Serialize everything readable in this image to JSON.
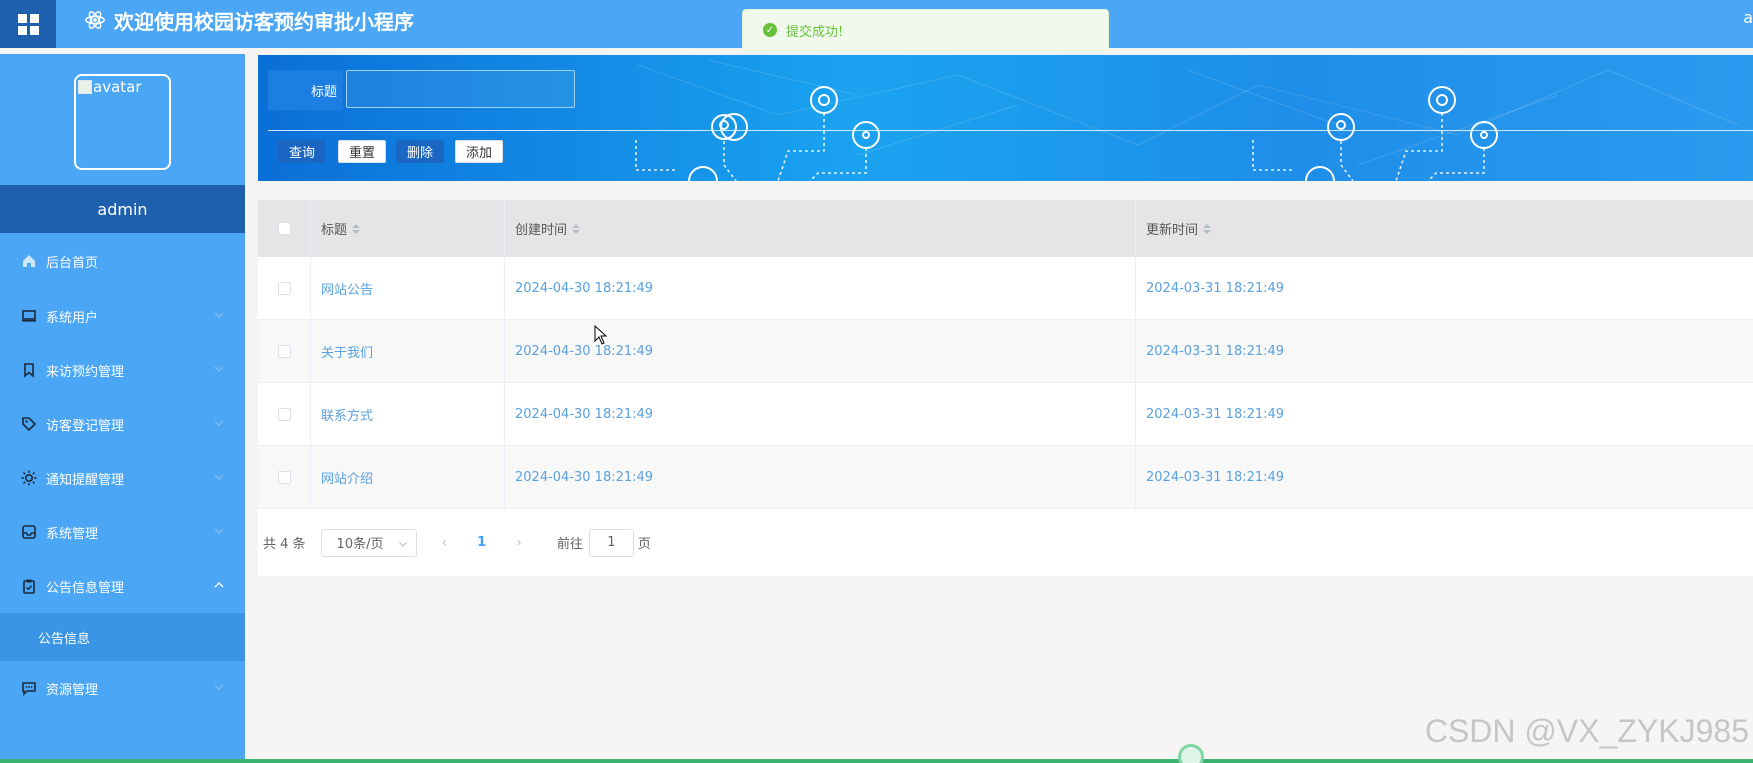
{
  "header": {
    "title": "欢迎使用校园访客预约审批小程序",
    "right_text": "a"
  },
  "toast": {
    "message": "提交成功!"
  },
  "sidebar": {
    "avatar_alt": "avatar",
    "username": "admin",
    "items": [
      {
        "label": "后台首页",
        "icon": "home-icon"
      },
      {
        "label": "系统用户",
        "icon": "monitor-icon"
      },
      {
        "label": "来访预约管理",
        "icon": "bookmark-icon"
      },
      {
        "label": "访客登记管理",
        "icon": "tag-icon"
      },
      {
        "label": "通知提醒管理",
        "icon": "sun-icon"
      },
      {
        "label": "系统管理",
        "icon": "inbox-icon"
      },
      {
        "label": "公告信息管理",
        "icon": "clipboard-icon"
      },
      {
        "label": "资源管理",
        "icon": "message-icon"
      }
    ],
    "sub_items": [
      {
        "label": "公告信息"
      }
    ]
  },
  "search": {
    "label": "标题",
    "value": "",
    "buttons": {
      "query": "查询",
      "reset": "重置",
      "delete": "删除",
      "add": "添加"
    }
  },
  "table": {
    "columns": [
      "标题",
      "创建时间",
      "更新时间"
    ],
    "rows": [
      {
        "title": "网站公告",
        "created": "2024-04-30 18:21:49",
        "updated": "2024-03-31 18:21:49"
      },
      {
        "title": "关于我们",
        "created": "2024-04-30 18:21:49",
        "updated": "2024-03-31 18:21:49"
      },
      {
        "title": "联系方式",
        "created": "2024-04-30 18:21:49",
        "updated": "2024-03-31 18:21:49"
      },
      {
        "title": "网站介绍",
        "created": "2024-04-30 18:21:49",
        "updated": "2024-03-31 18:21:49"
      }
    ]
  },
  "pagination": {
    "total": "共 4 条",
    "page_size": "10条/页",
    "current_page": "1",
    "goto_label": "前往",
    "goto_value": "1",
    "page_suffix": "页"
  },
  "watermark": "CSDN @VX_ZYKJ985",
  "colors": {
    "header": "#4ba6f5",
    "sidebar_dark": "#1e5fae",
    "link": "#5aa1de",
    "success": "#67c23a"
  }
}
